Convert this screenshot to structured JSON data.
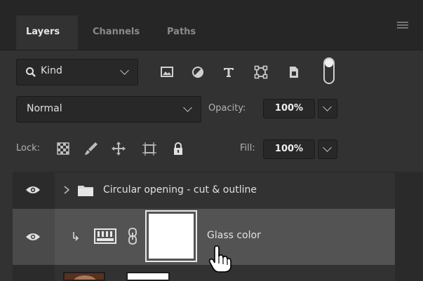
{
  "tabs": [
    "Layers",
    "Channels",
    "Paths"
  ],
  "filter": {
    "kind_label": "Kind"
  },
  "blend": {
    "mode": "Normal",
    "opacity_label": "Opacity:",
    "opacity_value": "100%"
  },
  "lock": {
    "label": "Lock:",
    "fill_label": "Fill:",
    "fill_value": "100%"
  },
  "layers": [
    {
      "name": "Circular opening - cut & outline",
      "type": "group"
    },
    {
      "name": "Glass color",
      "type": "gradient-fill",
      "selected": true
    }
  ],
  "colors": {
    "panel": "#323232",
    "tabbar": "#262626",
    "selected_row": "#535353",
    "field": "#282828"
  }
}
